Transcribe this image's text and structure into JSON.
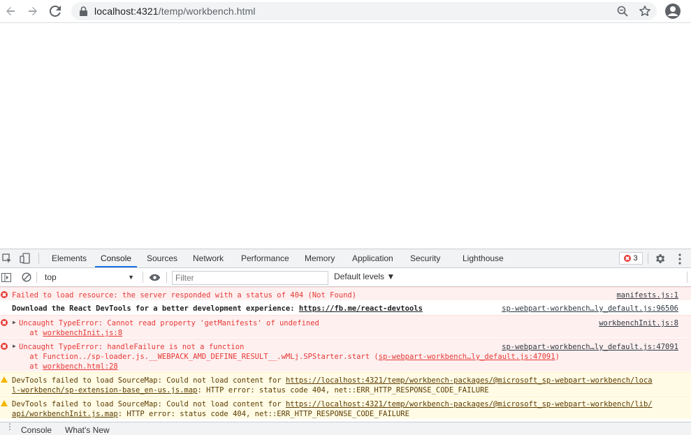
{
  "browser": {
    "url_host": "localhost:4321",
    "url_path": "/temp/workbench.html"
  },
  "devtools": {
    "tabs": [
      "Elements",
      "Console",
      "Sources",
      "Network",
      "Performance",
      "Memory",
      "Application",
      "Security",
      "Lighthouse"
    ],
    "active_tab": "Console",
    "error_count": "3",
    "context": "top",
    "filter_placeholder": "Filter",
    "levels_label": "Default levels ▼",
    "messages": [
      {
        "type": "error",
        "text": "Failed to load resource: the server responded with a status of 404 (Not Found)",
        "source": "manifests.js:1"
      },
      {
        "type": "info",
        "text": "Download the React DevTools for a better development experience: ",
        "link": "https://fb.me/react-devtools",
        "source": "sp-webpart-workbench…ly_default.js:96506"
      },
      {
        "type": "error",
        "text": "Uncaught TypeError: Cannot read property 'getManifests' of undefined",
        "trace_prefix": "    at ",
        "trace_link": "workbenchInit.js:8",
        "source": "workbenchInit.js:8"
      },
      {
        "type": "error",
        "text": "Uncaught TypeError: handleFailure is not a function",
        "trace1_prefix": "    at Function../sp-loader.js.__WEBPACK_AMD_DEFINE_RESULT__.wMLj.SPStarter.start (",
        "trace1_link": "sp-webpart-workbench…ly_default.js:47091",
        "trace1_suffix": ")",
        "trace2_prefix": "    at ",
        "trace2_link": "workbench.html:28",
        "source": "sp-webpart-workbench…ly_default.js:47091"
      },
      {
        "type": "warn",
        "text": "DevTools failed to load SourceMap: Could not load content for ",
        "link1": "https://localhost:4321/temp/workbench-packages/@microsoft_sp-webpart-workbench/loca",
        "link2": "l-workbench/sp-extension-base_en-us.js.map",
        "suffix": ": HTTP error: status code 404, net::ERR_HTTP_RESPONSE_CODE_FAILURE"
      },
      {
        "type": "warn",
        "text": "DevTools failed to load SourceMap: Could not load content for ",
        "link1": "https://localhost:4321/temp/workbench-packages/@microsoft_sp-webpart-workbench/lib/",
        "link2": "api/workbenchInit.js.map",
        "suffix": ": HTTP error: status code 404, net::ERR_HTTP_RESPONSE_CODE_FAILURE"
      }
    ],
    "drawer_tabs": [
      "Console",
      "What's New"
    ]
  },
  "colors": {
    "error_red": "#e53935",
    "active_tab_blue": "#1a73e8",
    "warning_yellow": "#f2b600"
  }
}
